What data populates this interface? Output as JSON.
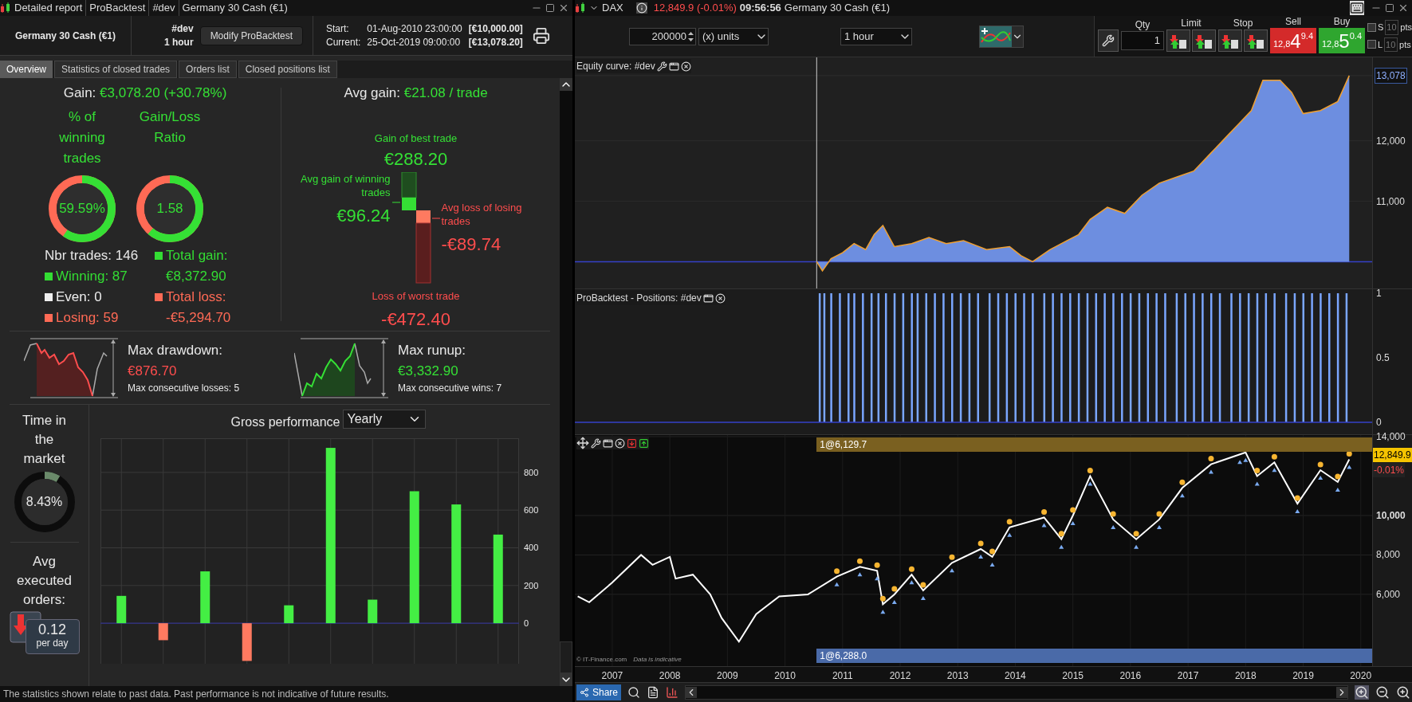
{
  "report": {
    "title_parts": [
      "Detailed report",
      "ProBacktest",
      "#dev",
      "Germany 30 Cash (€1)"
    ],
    "instrument": "Germany 30 Cash (€1)",
    "system": "#dev",
    "timeframe": "1 hour",
    "modify_button": "Modify ProBacktest",
    "periods": [
      {
        "label": "Start:",
        "date": "01-Aug-2010 23:00:00",
        "amount": "[€10,000.00]"
      },
      {
        "label": "Current:",
        "date": "25-Oct-2019 09:00:00",
        "amount": "[€13,078.20]"
      }
    ],
    "tabs": [
      {
        "label": "Overview",
        "selected": true
      },
      {
        "label": "Statistics of closed trades",
        "selected": false
      },
      {
        "label": "Orders list",
        "selected": false
      },
      {
        "label": "Closed positions list",
        "selected": false
      }
    ],
    "gain": {
      "label": "Gain:",
      "value": "€3,078.20 (+30.78%)"
    },
    "donuts": [
      {
        "title": "% of winning trades",
        "value": "59.59%",
        "level": 0.5959
      },
      {
        "title": "Gain/Loss Ratio",
        "value": "1.58",
        "level": 0.613
      }
    ],
    "trades": {
      "total": "Nbr trades: 146",
      "items": [
        {
          "text": "Winning: 87",
          "color": "#33dd33"
        },
        {
          "text": "Even: 0",
          "color": "#eeeeee"
        },
        {
          "text": "Losing: 59",
          "color": "#ff6a55"
        }
      ]
    },
    "totals": [
      {
        "label": "Total gain:",
        "value": "€8,372.90",
        "color": "#33dd33"
      },
      {
        "label": "Total loss:",
        "value": "-€5,294.70",
        "color": "#ff6a55"
      }
    ],
    "avg_gain": {
      "label": "Avg gain:",
      "value": "€21.08 / trade"
    },
    "best_trade": {
      "label": "Gain of best trade",
      "value": "€288.20"
    },
    "avg_win": {
      "label": "Avg gain of winning trades",
      "value": "€96.24"
    },
    "avg_loss": {
      "label": "Avg loss of losing trades",
      "value": "-€89.74"
    },
    "worst_trade": {
      "label": "Loss of worst trade",
      "value": "-€472.40"
    },
    "extremes": [
      {
        "kind": "drawdown",
        "title": "Max drawdown:",
        "value": "€876.70",
        "note": "Max consecutive losses: 5"
      },
      {
        "kind": "runup",
        "title": "Max runup:",
        "value": "€3,332.90",
        "note": "Max consecutive wins: 7"
      }
    ],
    "time_in_market": {
      "title": "Time in the market",
      "value": "8.43%",
      "level": 0.0843
    },
    "avg_orders": {
      "title": "Avg executed orders:",
      "value": "0.12",
      "unit": "per day"
    },
    "gross": {
      "title": "Gross performance",
      "period": "Yearly",
      "chart_data": {
        "type": "bar",
        "values": [
          145,
          -90,
          275,
          -200,
          95,
          930,
          125,
          700,
          630,
          470
        ],
        "ylim": [
          -215,
          981
        ],
        "yticks": [
          0,
          200,
          400,
          600,
          800
        ],
        "grid": true,
        "ref_lines": [
          {
            "axis": "y",
            "value": 0
          }
        ]
      }
    },
    "disclaimer": "The statistics shown relate to past data. Past performance is not indicative of future results."
  },
  "chart_window": {
    "symbol": "DAX",
    "price": "12,849.9 (-0.01%)",
    "time": "09:56:56",
    "instrument": "Germany 30 Cash (€1)",
    "quantity": "200000",
    "units": "(x) units",
    "timeframe": "1 hour",
    "order_panel": {
      "qty_label": "Qty",
      "qty": "1",
      "limit_label": "Limit",
      "stop_label": "Stop",
      "sell": {
        "label": "Sell",
        "prefix": "12,8",
        "big": "4",
        "small": "9.4"
      },
      "buy": {
        "label": "Buy",
        "prefix": "12,8",
        "big": "5",
        "small": "0.4"
      },
      "protections": [
        {
          "letter": "S",
          "placeholder": "10",
          "unit": "pts",
          "checked": false
        },
        {
          "letter": "L",
          "placeholder": "10",
          "unit": "pts",
          "checked": false
        }
      ]
    },
    "equity_pane": {
      "title": "Equity curve: #dev",
      "chart_data": {
        "type": "area",
        "grid": true,
        "ref_lines": [
          {
            "axis": "y",
            "value": 10000
          },
          {
            "axis": "x",
            "value": 2010.55
          }
        ],
        "xlim": [
          2006.35,
          2020.89
        ],
        "ylim": [
          9558,
          13380
        ],
        "x": [
          2010.55,
          2010.65,
          2010.8,
          2011.0,
          2011.2,
          2011.4,
          2011.55,
          2011.7,
          2011.9,
          2012.2,
          2012.5,
          2012.8,
          2013.1,
          2013.5,
          2013.9,
          2014.1,
          2014.3,
          2014.6,
          2014.9,
          2015.1,
          2015.3,
          2015.6,
          2015.9,
          2016.2,
          2016.5,
          2016.8,
          2017.1,
          2017.4,
          2017.7,
          2017.9,
          2018.1,
          2018.3,
          2018.6,
          2018.8,
          2019.0,
          2019.3,
          2019.6,
          2019.8
        ],
        "series": [
          {
            "color": "#6d8ee0",
            "values": [
              10000,
              9850,
              10050,
              10150,
              10300,
              10200,
              10450,
              10600,
              10250,
              10300,
              10400,
              10300,
              10350,
              10200,
              10250,
              10100,
              10000,
              10200,
              10350,
              10450,
              10700,
              10900,
              10800,
              11100,
              11300,
              11400,
              11500,
              11800,
              12100,
              12300,
              12500,
              13000,
              13000,
              12800,
              12450,
              12500,
              12650,
              13078
            ]
          }
        ],
        "yticks": [
          {
            "value": 13078,
            "label": "13,078"
          },
          {
            "value": 12000,
            "label": "12,000"
          },
          {
            "value": 11000,
            "label": "11,000"
          }
        ]
      }
    },
    "positions_pane": {
      "title": "ProBacktest - Positions: #dev",
      "chart_data": {
        "type": "bar",
        "xlim": [
          2006.35,
          2020.89
        ],
        "ylim": [
          -0.099,
          1.031
        ],
        "yticks": [
          {
            "value": 1,
            "label": "1"
          },
          {
            "value": 0.5,
            "label": "0.5"
          },
          {
            "value": 0,
            "label": "0"
          }
        ],
        "ref_lines": [
          {
            "axis": "y",
            "value": 0
          }
        ],
        "x": [
          2010.6,
          2010.68,
          2010.8,
          2010.95,
          2011.1,
          2011.2,
          2011.35,
          2011.5,
          2011.62,
          2011.75,
          2011.9,
          2012.05,
          2012.2,
          2012.3,
          2012.45,
          2012.6,
          2012.75,
          2012.9,
          2013.05,
          2013.2,
          2013.35,
          2013.55,
          2013.7,
          2013.85,
          2014.0,
          2014.15,
          2014.3,
          2014.5,
          2014.65,
          2014.8,
          2014.95,
          2015.1,
          2015.25,
          2015.4,
          2015.55,
          2015.7,
          2015.85,
          2016.0,
          2016.15,
          2016.3,
          2016.45,
          2016.6,
          2016.8,
          2016.95,
          2017.1,
          2017.25,
          2017.4,
          2017.55,
          2017.75,
          2017.9,
          2018.05,
          2018.2,
          2018.35,
          2018.5,
          2018.7,
          2018.85,
          2019.0,
          2019.15,
          2019.3,
          2019.45,
          2019.6,
          2019.75
        ],
        "values": [
          1,
          1,
          1,
          1,
          1,
          1,
          1,
          1,
          1,
          1,
          1,
          1,
          1,
          1,
          1,
          1,
          1,
          1,
          1,
          1,
          1,
          1,
          1,
          1,
          1,
          1,
          1,
          1,
          1,
          1,
          1,
          1,
          1,
          1,
          1,
          1,
          1,
          1,
          1,
          1,
          1,
          1,
          1,
          1,
          1,
          1,
          1,
          1,
          1,
          1,
          1,
          1,
          1,
          1,
          1,
          1,
          1,
          1,
          1,
          1,
          1,
          1
        ]
      }
    },
    "price_pane": {
      "top_band": "1@6,129.7",
      "bottom_band": "1@6,288.0",
      "credit": "© IT-Finance.com",
      "credit_note": "Data is indicative",
      "last_price": "12,849.9",
      "change": "-0.01%",
      "chart_data": {
        "type": "line",
        "grid": true,
        "xlim": [
          2006.35,
          2020.89
        ],
        "ylim": [
          2360,
          14080
        ],
        "x": [
          2006.4,
          2006.6,
          2007.0,
          2007.5,
          2007.7,
          2008.0,
          2008.1,
          2008.4,
          2008.7,
          2008.9,
          2009.2,
          2009.5,
          2009.9,
          2010.4,
          2010.9,
          2011.3,
          2011.6,
          2011.7,
          2011.9,
          2012.2,
          2012.4,
          2012.9,
          2013.4,
          2013.6,
          2013.9,
          2014.5,
          2014.8,
          2015.0,
          2015.3,
          2015.7,
          2016.1,
          2016.5,
          2016.9,
          2017.4,
          2017.9,
          2018.0,
          2018.2,
          2018.5,
          2018.9,
          2019.3,
          2019.6,
          2019.8
        ],
        "series": [
          {
            "color": "#ffffff",
            "values": [
              5900,
              5600,
              6600,
              8000,
              7500,
              7900,
              6800,
              7000,
              6000,
              4800,
              3600,
              5000,
              5900,
              6000,
              6900,
              7400,
              7200,
              5500,
              6000,
              7000,
              6200,
              7600,
              8300,
              7900,
              9400,
              9900,
              8800,
              10000,
              12000,
              9800,
              8800,
              9800,
              11400,
              12600,
              13100,
              13200,
              12000,
              12700,
              10600,
              12300,
              11700,
              12850
            ]
          }
        ],
        "yticks": [
          {
            "value": 14000,
            "label": "14,000"
          },
          {
            "value": 10000,
            "label": "10,000"
          },
          {
            "value": 8000,
            "label": "8,000"
          },
          {
            "value": 6000,
            "label": "6,000"
          }
        ],
        "xticks": [
          {
            "value": 2007,
            "label": "2007"
          },
          {
            "value": 2008,
            "label": "2008"
          },
          {
            "value": 2009,
            "label": "2009"
          },
          {
            "value": 2010,
            "label": "2010"
          },
          {
            "value": 2011,
            "label": "2011"
          },
          {
            "value": 2012,
            "label": "2012"
          },
          {
            "value": 2013,
            "label": "2013"
          },
          {
            "value": 2014,
            "label": "2014"
          },
          {
            "value": 2015,
            "label": "2015"
          },
          {
            "value": 2016,
            "label": "2016"
          },
          {
            "value": 2017,
            "label": "2017"
          },
          {
            "value": 2018,
            "label": "2018"
          },
          {
            "value": 2019,
            "label": "2019"
          },
          {
            "value": 2020,
            "label": "2020"
          }
        ]
      }
    },
    "share_button": "Share"
  }
}
